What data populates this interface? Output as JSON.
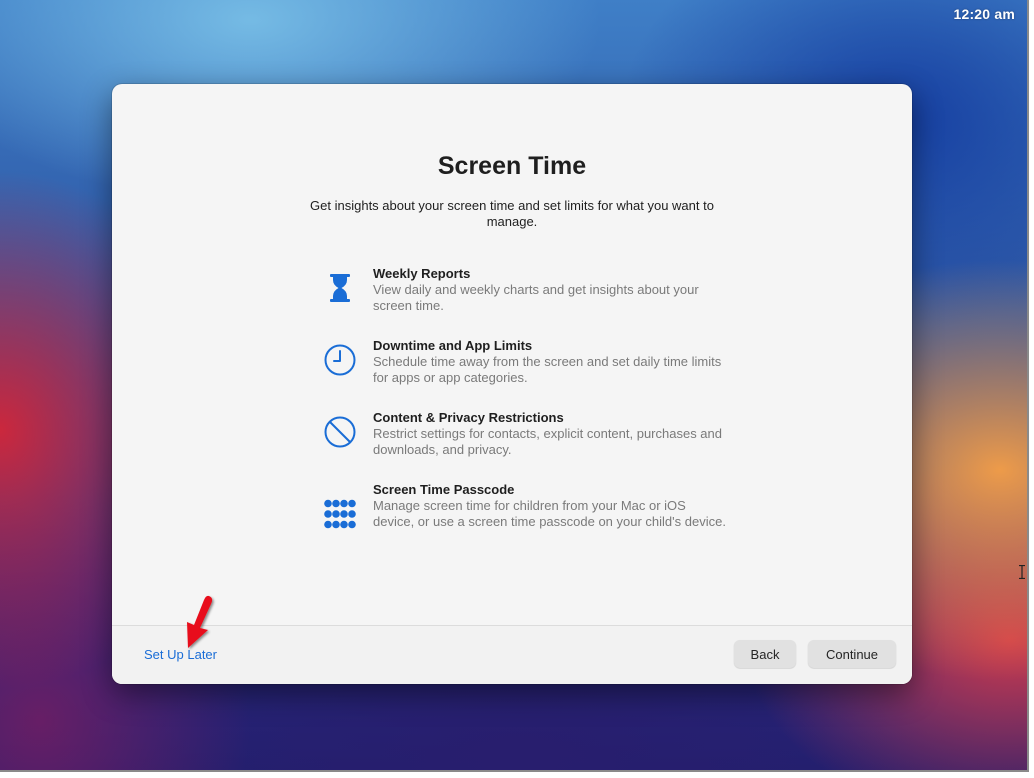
{
  "menubar": {
    "clock": "12:20 am"
  },
  "dialog": {
    "title": "Screen Time",
    "subtitle": "Get insights about your screen time and set limits for what you want to manage.",
    "features": [
      {
        "icon": "hourglass-icon",
        "title": "Weekly Reports",
        "description": "View daily and weekly charts and get insights about your screen time."
      },
      {
        "icon": "clock-icon",
        "title": "Downtime and App Limits",
        "description": "Schedule time away from the screen and set daily time limits for apps or app categories."
      },
      {
        "icon": "restricted-icon",
        "title": "Content & Privacy Restrictions",
        "description": "Restrict settings for contacts, explicit content, purchases and downloads, and privacy."
      },
      {
        "icon": "passcode-keypad-icon",
        "title": "Screen Time Passcode",
        "description": "Manage screen time for children from your Mac or iOS device, or use a screen time passcode on your child's device."
      }
    ],
    "footer": {
      "setup_later": "Set Up Later",
      "back": "Back",
      "continue": "Continue"
    }
  },
  "colors": {
    "accent": "#1a6dd6",
    "annotation_arrow": "#e8101a"
  }
}
